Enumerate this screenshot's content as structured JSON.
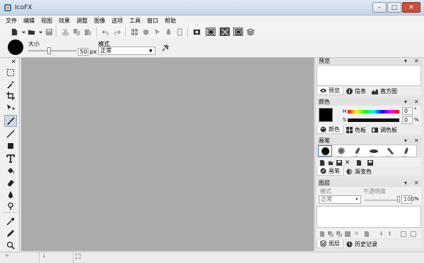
{
  "window": {
    "title": "IcoFX",
    "minimize_glyph": "–",
    "maximize_glyph": "□",
    "close_glyph": "✕"
  },
  "menu": {
    "items": [
      "文件",
      "编辑",
      "视图",
      "效果",
      "调整",
      "图像",
      "选项",
      "工具",
      "窗口",
      "帮助"
    ]
  },
  "toolbar": {
    "icons": [
      "new-document-icon",
      "open-folder-icon",
      "save-icon",
      "cut-icon",
      "copy-icon",
      "paste-icon",
      "undo-icon",
      "redo-icon",
      "windows-icon",
      "apple-icon",
      "cursor-icon",
      "android-icon",
      "mobile-icon",
      "screenshot-icon",
      "grid-view-icon",
      "grid-view-alt-icon",
      "grid-view-third-icon",
      "layers-stack-icon"
    ]
  },
  "options": {
    "size_label": "大小",
    "size_value": "50",
    "size_unit": "px",
    "size_slider_fraction": 0.42,
    "mode_label": "模式",
    "mode_value": "正常"
  },
  "tools": [
    "marquee-select-icon",
    "magic-wand-icon",
    "crop-icon",
    "move-icon",
    "brush-icon",
    "line-icon",
    "rectangle-icon",
    "text-icon",
    "fill-bucket-icon",
    "eraser-icon",
    "blur-drop-icon",
    "burn-icon",
    "eyedropper-icon",
    "pen-icon",
    "zoom-icon"
  ],
  "panels": {
    "preview": {
      "title": "预览",
      "tabs": [
        {
          "label": "预览",
          "icon": "eye-icon",
          "active": true
        },
        {
          "label": "信息",
          "icon": "info-icon",
          "active": false
        },
        {
          "label": "直方图",
          "icon": "histogram-icon",
          "active": false
        }
      ]
    },
    "color": {
      "title": "颜色",
      "h_label": "H",
      "s_label": "S",
      "h_value": "0",
      "s_value": "0",
      "h_unit": "°",
      "s_unit": "%",
      "swatch_color": "#000000",
      "tabs": [
        {
          "label": "颜色",
          "icon": "palette-icon",
          "active": true
        },
        {
          "label": "色板",
          "icon": "swatches-icon",
          "active": false
        },
        {
          "label": "调色板",
          "icon": "color-board-icon",
          "active": false
        }
      ]
    },
    "brush": {
      "title": "画笔",
      "sizes": [
        "50",
        "50",
        "50",
        "50",
        "50",
        "50"
      ],
      "tabs": [
        {
          "label": "画笔",
          "icon": "brush-tab-icon",
          "active": true
        },
        {
          "label": "渐变色",
          "icon": "gradient-icon",
          "active": false
        }
      ]
    },
    "layers": {
      "title": "图层",
      "mode_label": "模式",
      "opacity_label": "不透明度",
      "mode_value": "正常",
      "opacity_value": "100",
      "opacity_unit": "%",
      "tabs": [
        {
          "label": "图层",
          "icon": "layers-icon",
          "active": true
        },
        {
          "label": "历史记录",
          "icon": "history-icon",
          "active": false
        }
      ]
    }
  },
  "colors": {
    "canvas": "#ababab",
    "accent_close": "#c8503c"
  }
}
